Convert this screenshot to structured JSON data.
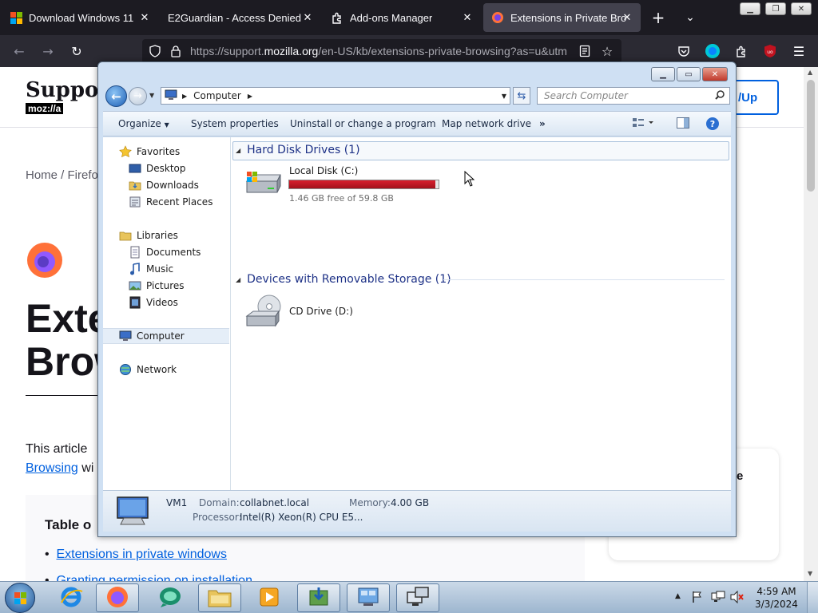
{
  "firefox": {
    "tabs": [
      {
        "title": "Download Windows 11",
        "icon": "windows-logo-icon"
      },
      {
        "title": "E2Guardian - Access Denied",
        "icon": "none"
      },
      {
        "title": "Add-ons Manager",
        "icon": "puzzle-icon"
      },
      {
        "title": "Extensions in Private Brows",
        "icon": "firefox-icon",
        "active": true
      }
    ],
    "url_prefix": "https://support.",
    "url_domain": "mozilla.org",
    "url_suffix": "/en-US/kb/extensions-private-browsing?as=u&utm"
  },
  "webpage": {
    "logo_text": "Support",
    "logo_sub": "moz://a",
    "signup_fragment": "/Up",
    "breadcrumb": "Home / Firefo",
    "title_line1": "Exte",
    "title_line2": "Brow",
    "intro_text": "This article",
    "intro_link": "Browsing",
    "intro_after": "wi",
    "toc_title": "Table o",
    "toc_link1": "Extensions in private windows",
    "toc_link2": "Granting permission on installation",
    "side_fragment": "e"
  },
  "explorer": {
    "breadcrumb": "Computer",
    "search_placeholder": "Search Computer",
    "toolbar": {
      "organize": "Organize",
      "system_properties": "System properties",
      "uninstall": "Uninstall or change a program",
      "map_drive": "Map network drive",
      "more": "»"
    },
    "nav": {
      "favorites": "Favorites",
      "desktop": "Desktop",
      "downloads": "Downloads",
      "recent_places": "Recent Places",
      "libraries": "Libraries",
      "documents": "Documents",
      "music": "Music",
      "pictures": "Pictures",
      "videos": "Videos",
      "computer": "Computer",
      "network": "Network"
    },
    "groups": {
      "hdd": "Hard Disk Drives (1)",
      "removable": "Devices with Removable Storage (1)"
    },
    "drive_c": {
      "name": "Local Disk (C:)",
      "free": "1.46 GB free of 59.8 GB",
      "used_fraction": 0.976,
      "bar_color": "#d8202e"
    },
    "drive_d": {
      "name": "CD Drive (D:)"
    },
    "details": {
      "computer_name": "VM1",
      "domain_label": "Domain:",
      "domain_value": "collabnet.local",
      "memory_label": "Memory:",
      "memory_value": "4.00 GB",
      "processor_label": "Processor:",
      "processor_value": "Intel(R) Xeon(R) CPU E5..."
    }
  },
  "taskbar": {
    "time": "4:59 AM",
    "date": "3/3/2024"
  }
}
